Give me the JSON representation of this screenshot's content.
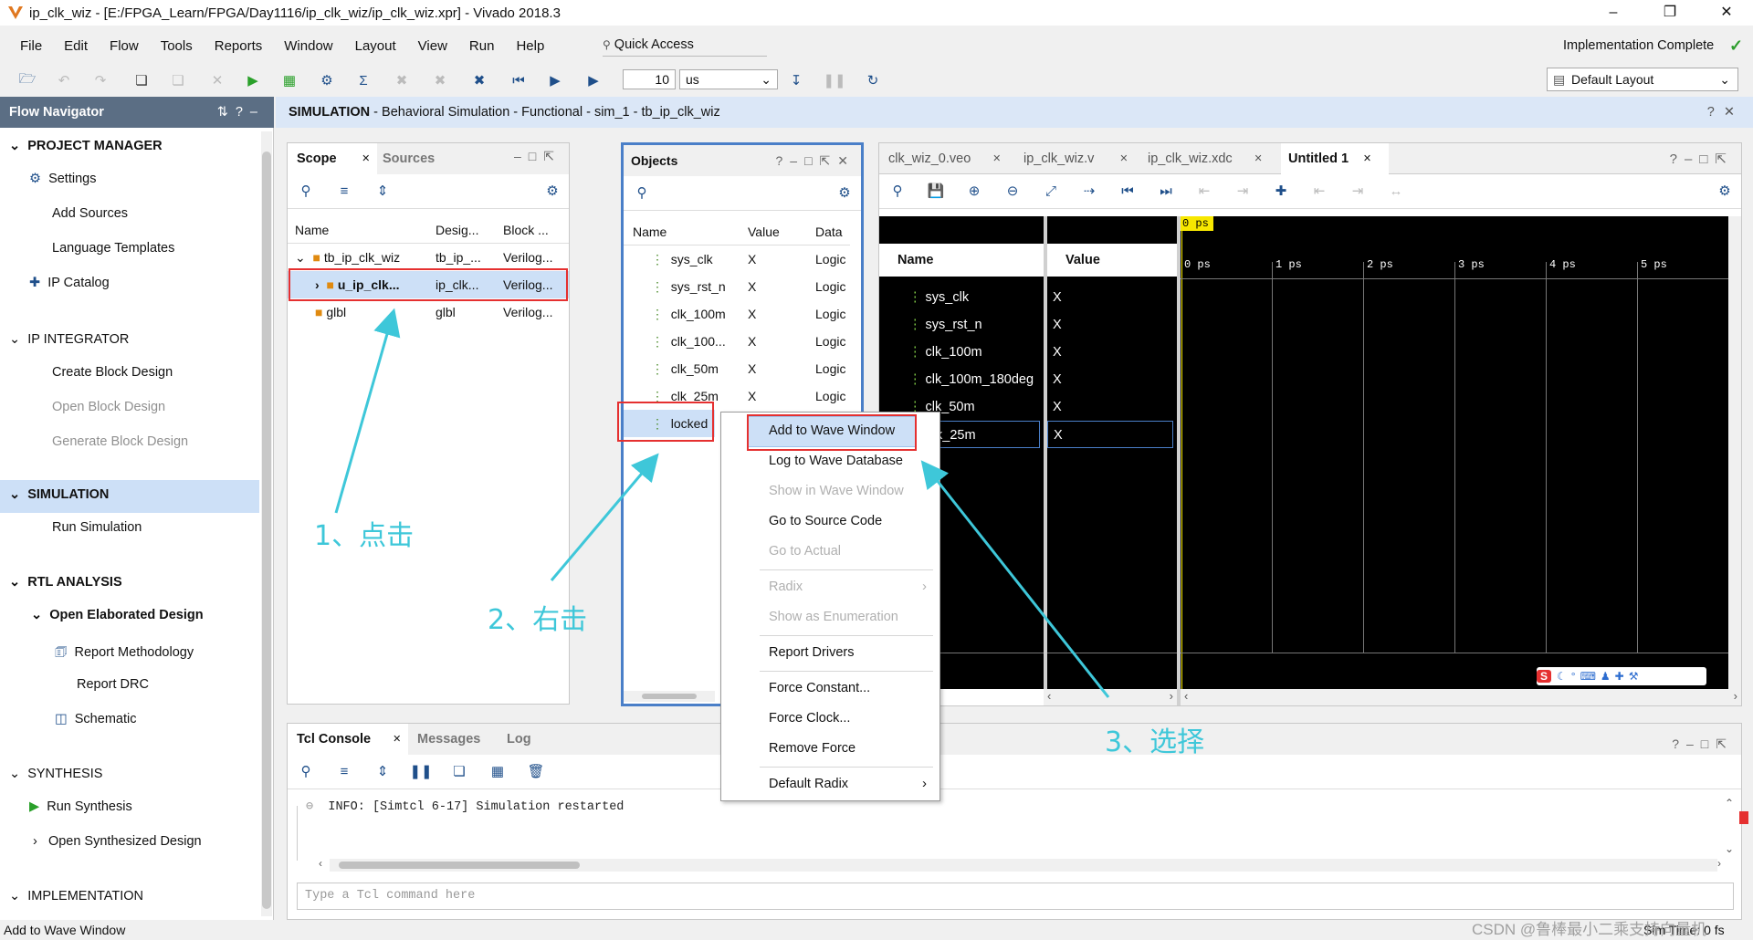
{
  "window": {
    "title": "ip_clk_wiz - [E:/FPGA_Learn/FPGA/Day1116/ip_clk_wiz/ip_clk_wiz.xpr] - Vivado 2018.3"
  },
  "menu": [
    "File",
    "Edit",
    "Flow",
    "Tools",
    "Reports",
    "Window",
    "Layout",
    "View",
    "Run",
    "Help"
  ],
  "quick_access": "Quick Access",
  "status_right": "Implementation Complete",
  "toolbar": {
    "time_value": "10",
    "time_unit": "us",
    "layout": "Default Layout"
  },
  "flow_nav": {
    "title": "Flow Navigator",
    "project_manager": "PROJECT MANAGER",
    "settings": "Settings",
    "add_sources": "Add Sources",
    "language_templates": "Language Templates",
    "ip_catalog": "IP Catalog",
    "ip_integrator": "IP INTEGRATOR",
    "create_bd": "Create Block Design",
    "open_bd": "Open Block Design",
    "generate_bd": "Generate Block Design",
    "simulation": "SIMULATION",
    "run_sim": "Run Simulation",
    "rtl": "RTL ANALYSIS",
    "open_elab": "Open Elaborated Design",
    "report_meth": "Report Methodology",
    "report_drc": "Report DRC",
    "schematic": "Schematic",
    "synthesis": "SYNTHESIS",
    "run_synth": "Run Synthesis",
    "open_synth": "Open Synthesized Design",
    "implementation": "IMPLEMENTATION"
  },
  "sim_header": {
    "prefix": "SIMULATION",
    "rest": " - Behavioral Simulation - Functional - sim_1 - tb_ip_clk_wiz"
  },
  "scope": {
    "tabs": [
      "Scope",
      "Sources"
    ],
    "headers": [
      "Name",
      "Desig...",
      "Block ..."
    ],
    "rows": [
      {
        "name": "tb_ip_clk_wiz",
        "design": "tb_ip_...",
        "block": "Verilog..."
      },
      {
        "name": "u_ip_clk...",
        "design": "ip_clk...",
        "block": "Verilog..."
      },
      {
        "name": "glbl",
        "design": "glbl",
        "block": "Verilog..."
      }
    ]
  },
  "objects": {
    "title": "Objects",
    "headers": [
      "Name",
      "Value",
      "Data"
    ],
    "rows": [
      {
        "name": "sys_clk",
        "value": "X",
        "data": "Logic"
      },
      {
        "name": "sys_rst_n",
        "value": "X",
        "data": "Logic"
      },
      {
        "name": "clk_100m",
        "value": "X",
        "data": "Logic"
      },
      {
        "name": "clk_100...",
        "value": "X",
        "data": "Logic"
      },
      {
        "name": "clk_50m",
        "value": "X",
        "data": "Logic"
      },
      {
        "name": "clk_25m",
        "value": "X",
        "data": "Logic"
      },
      {
        "name": "locked",
        "value": "",
        "data": ""
      }
    ]
  },
  "context_menu": {
    "items": [
      "Add to Wave Window",
      "Log to Wave Database",
      "Show in Wave Window",
      "Go to Source Code",
      "Go to Actual",
      "Radix",
      "Show as Enumeration",
      "Report Drivers",
      "Force Constant...",
      "Force Clock...",
      "Remove Force",
      "Default Radix"
    ]
  },
  "editor_tabs": [
    "clk_wiz_0.veo",
    "ip_clk_wiz.v",
    "ip_clk_wiz.xdc",
    "Untitled 1"
  ],
  "wave": {
    "name_header": "Name",
    "value_header": "Value",
    "cursor": "0 ps",
    "ticks": [
      "0 ps",
      "1 ps",
      "2 ps",
      "3 ps",
      "4 ps",
      "5 ps"
    ],
    "signals": [
      {
        "name": "sys_clk",
        "value": "X"
      },
      {
        "name": "sys_rst_n",
        "value": "X"
      },
      {
        "name": "clk_100m",
        "value": "X"
      },
      {
        "name": "clk_100m_180deg",
        "value": "X"
      },
      {
        "name": "clk_50m",
        "value": "X"
      },
      {
        "name": "clk_25m",
        "value": "X"
      }
    ]
  },
  "console": {
    "tabs": [
      "Tcl Console",
      "Messages",
      "Log"
    ],
    "line": "INFO: [Simtcl 6-17] Simulation restarted",
    "placeholder": "Type a Tcl command here"
  },
  "statusbar": {
    "left": "Add to Wave Window",
    "right": "Sim Time: 0 fs",
    "watermark": "CSDN @鲁棒最小二乘支持向量机"
  },
  "annotations": {
    "a1": "1、点击",
    "a2": "2、右击",
    "a3": "3、选择"
  },
  "colors": {
    "accent_blue": "#4a7fc8",
    "selection": "#cde0f7",
    "annotation": "#3ec7d9",
    "highlight_red": "#e53030"
  }
}
